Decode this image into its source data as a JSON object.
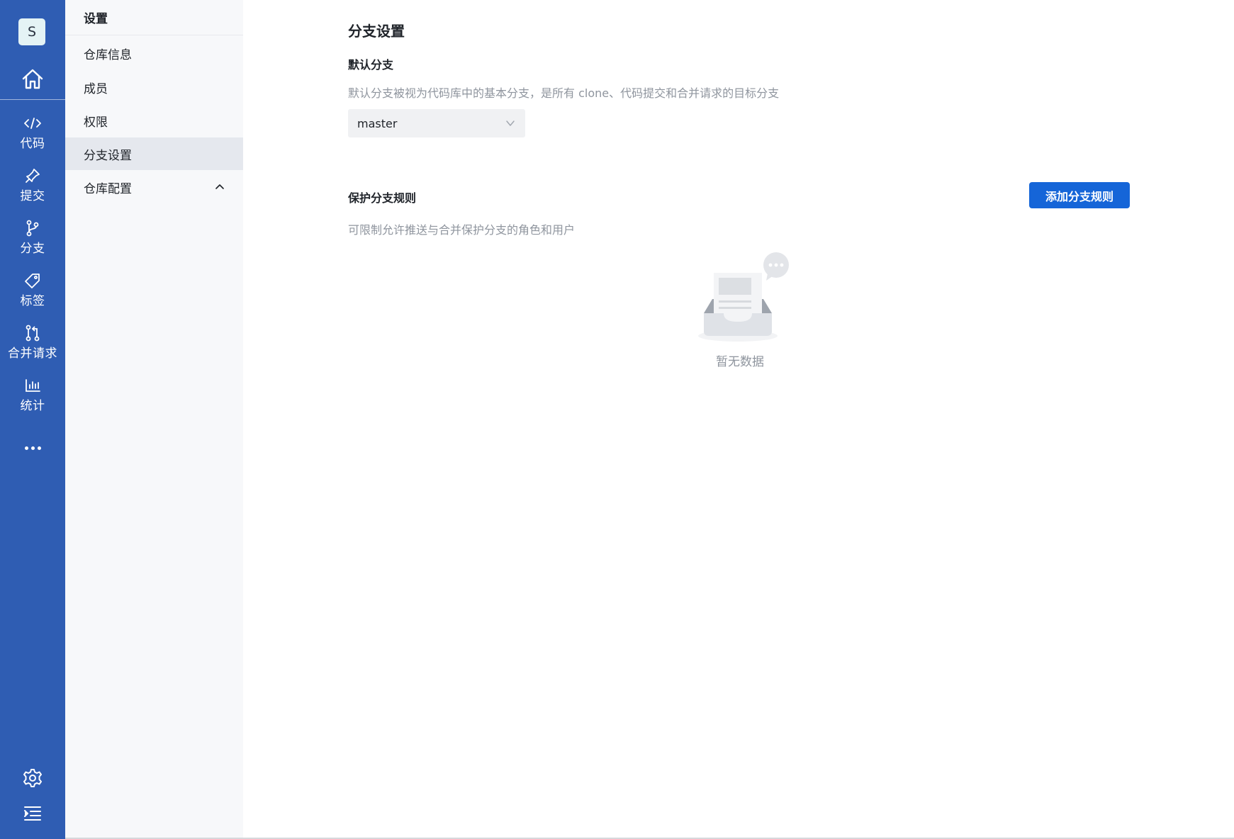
{
  "rail": {
    "avatar_letter": "S",
    "items": [
      {
        "label": "代码",
        "icon": "code-icon"
      },
      {
        "label": "提交",
        "icon": "pin-icon"
      },
      {
        "label": "分支",
        "icon": "branch-icon"
      },
      {
        "label": "标签",
        "icon": "tag-icon"
      },
      {
        "label": "合并请求",
        "icon": "merge-request-icon"
      },
      {
        "label": "统计",
        "icon": "chart-icon"
      }
    ]
  },
  "subnav": {
    "title": "设置",
    "items": [
      {
        "label": "仓库信息"
      },
      {
        "label": "成员"
      },
      {
        "label": "权限"
      },
      {
        "label": "分支设置"
      },
      {
        "label": "仓库配置"
      }
    ]
  },
  "main": {
    "title": "分支设置",
    "default_branch": {
      "title": "默认分支",
      "desc": "默认分支被视为代码库中的基本分支，是所有 clone、代码提交和合并请求的目标分支",
      "selected": "master"
    },
    "protect_rules": {
      "title": "保护分支规则",
      "desc": "可限制允许推送与合并保护分支的角色和用户",
      "add_button": "添加分支规则",
      "empty_text": "暂无数据"
    }
  },
  "colors": {
    "rail_bg": "#2f5db3",
    "primary_button": "#1565d8",
    "active_item_bg": "#e5e8ee"
  }
}
